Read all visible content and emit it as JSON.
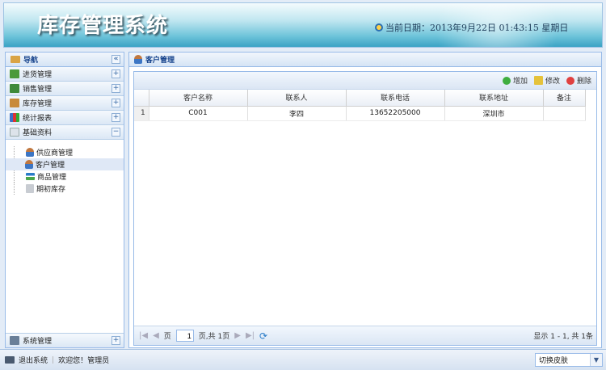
{
  "header": {
    "title": "库存管理系统",
    "date_text": "当前日期：2013年9月22日  01:43:15 星期日"
  },
  "nav": {
    "title": "导航",
    "collapse_icon": "«",
    "sections": [
      {
        "label": "进货管理",
        "color": "#4b9a3a"
      },
      {
        "label": "销售管理",
        "color": "#3f8a3a"
      },
      {
        "label": "库存管理",
        "color": "#c88a3a"
      },
      {
        "label": "统计报表",
        "color": "#3b6fc7"
      },
      {
        "label": "基础资料",
        "color": "#b7c3d3"
      }
    ],
    "sub_items": [
      "供应商管理",
      "客户管理",
      "商品管理",
      "期初库存"
    ],
    "system": "系统管理"
  },
  "main": {
    "title": "客户管理",
    "toolbar": {
      "add": "增加",
      "edit": "修改",
      "delete": "删除"
    },
    "columns": [
      "客户名称",
      "联系人",
      "联系电话",
      "联系地址",
      "备注"
    ],
    "rows": [
      {
        "n": "1",
        "name": "C001",
        "contact": "李四",
        "phone": "13652205000",
        "address": "深圳市",
        "remark": ""
      }
    ],
    "pager": {
      "page_label": "页",
      "page_value": "1",
      "total_pages": "页,共 1页",
      "summary": "显示 1 - 1,  共 1条"
    }
  },
  "bottom": {
    "logout": "退出系统",
    "welcome": "欢迎您！管理员",
    "skin": "切换皮肤"
  }
}
